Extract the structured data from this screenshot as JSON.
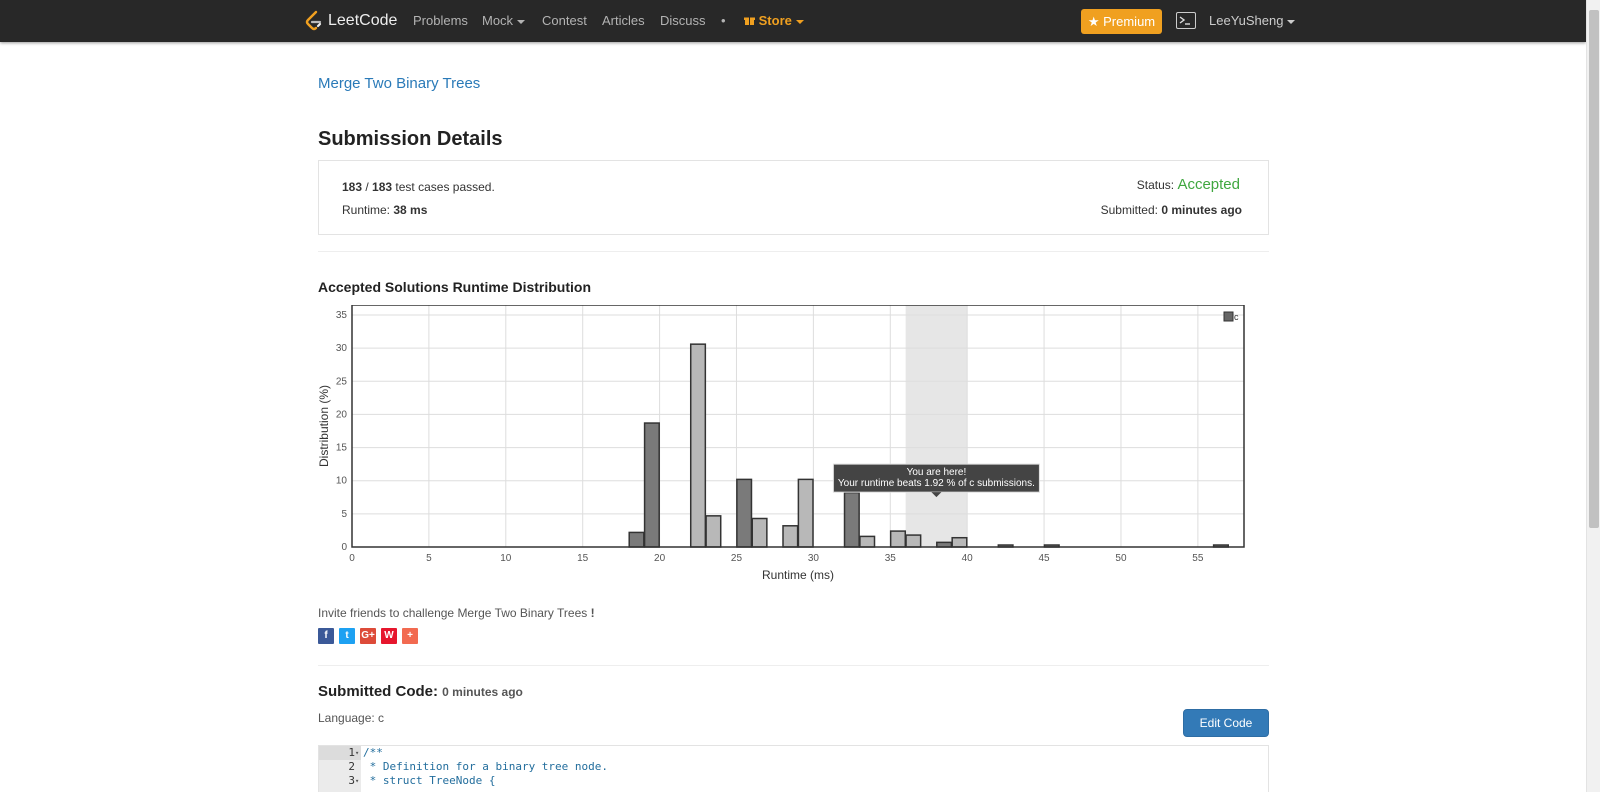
{
  "nav": {
    "logo_text": "LeetCode",
    "items": [
      "Problems",
      "Mock",
      "Contest",
      "Articles",
      "Discuss",
      "•"
    ],
    "store": "Store",
    "premium": "Premium",
    "user": "LeeYuSheng"
  },
  "problem": {
    "title": "Merge Two Binary Trees"
  },
  "submission": {
    "heading": "Submission Details",
    "passed": "183",
    "total": "183",
    "passed_suffix": "test cases passed.",
    "runtime_label": "Runtime:",
    "runtime_value": "38 ms",
    "status_label": "Status:",
    "status_value": "Accepted",
    "submitted_label": "Submitted:",
    "submitted_value": "0 minutes ago"
  },
  "distribution": {
    "heading": "Accepted Solutions Runtime Distribution"
  },
  "chart_data": {
    "type": "bar",
    "xlabel": "Runtime (ms)",
    "ylabel": "Distribution (%)",
    "xlim": [
      0,
      58
    ],
    "ylim": [
      0,
      35
    ],
    "xticks": [
      0,
      5,
      10,
      15,
      20,
      25,
      30,
      35,
      40,
      45,
      50,
      55
    ],
    "yticks": [
      0,
      5,
      10,
      15,
      20,
      25,
      30,
      35
    ],
    "grid": true,
    "legend": {
      "label": "c",
      "position": "top-right"
    },
    "highlight_range": [
      36,
      40
    ],
    "bars": [
      {
        "x": 18.5,
        "value": 2.2,
        "shade": "dark"
      },
      {
        "x": 19.5,
        "value": 18.7,
        "shade": "dark"
      },
      {
        "x": 22.5,
        "value": 30.6,
        "shade": "light"
      },
      {
        "x": 23.5,
        "value": 4.7,
        "shade": "light"
      },
      {
        "x": 25.5,
        "value": 10.2,
        "shade": "dark"
      },
      {
        "x": 26.5,
        "value": 4.3,
        "shade": "light"
      },
      {
        "x": 28.5,
        "value": 3.2,
        "shade": "light"
      },
      {
        "x": 29.5,
        "value": 10.2,
        "shade": "light"
      },
      {
        "x": 32.5,
        "value": 8.2,
        "shade": "dark"
      },
      {
        "x": 33.5,
        "value": 1.6,
        "shade": "light"
      },
      {
        "x": 35.5,
        "value": 2.4,
        "shade": "light"
      },
      {
        "x": 36.5,
        "value": 1.8,
        "shade": "light"
      },
      {
        "x": 38.5,
        "value": 0.7,
        "shade": "dark"
      },
      {
        "x": 39.5,
        "value": 1.4,
        "shade": "light"
      },
      {
        "x": 42.5,
        "value": 0.3,
        "shade": "dark"
      },
      {
        "x": 45.5,
        "value": 0.3,
        "shade": "dark"
      },
      {
        "x": 56.5,
        "value": 0.3,
        "shade": "dark"
      }
    ],
    "tooltip": {
      "line1": "You are here!",
      "line2": "Your runtime beats 1.92 % of c submissions."
    }
  },
  "invite": {
    "prefix": "Invite friends to challenge",
    "problem": "Merge Two Binary Trees",
    "suffix": "!"
  },
  "shares": [
    {
      "icon": "facebook-icon",
      "glyph": "f",
      "color": "#3b5998"
    },
    {
      "icon": "twitter-icon",
      "glyph": "t",
      "color": "#1da1f2"
    },
    {
      "icon": "google-plus-icon",
      "glyph": "G+",
      "color": "#dd4b39"
    },
    {
      "icon": "weibo-icon",
      "glyph": "W",
      "color": "#e6162d"
    },
    {
      "icon": "more-share-icon",
      "glyph": "+",
      "color": "#f26a50"
    }
  ],
  "code": {
    "heading": "Submitted Code:",
    "ago": "0 minutes ago",
    "language": "Language: c",
    "edit_button": "Edit Code",
    "lines": [
      {
        "num": "1",
        "fold": "▾",
        "text": "/**"
      },
      {
        "num": "2",
        "fold": "",
        "text": " * Definition for a binary tree node."
      },
      {
        "num": "3",
        "fold": "▾",
        "text": " * struct TreeNode {"
      }
    ]
  }
}
